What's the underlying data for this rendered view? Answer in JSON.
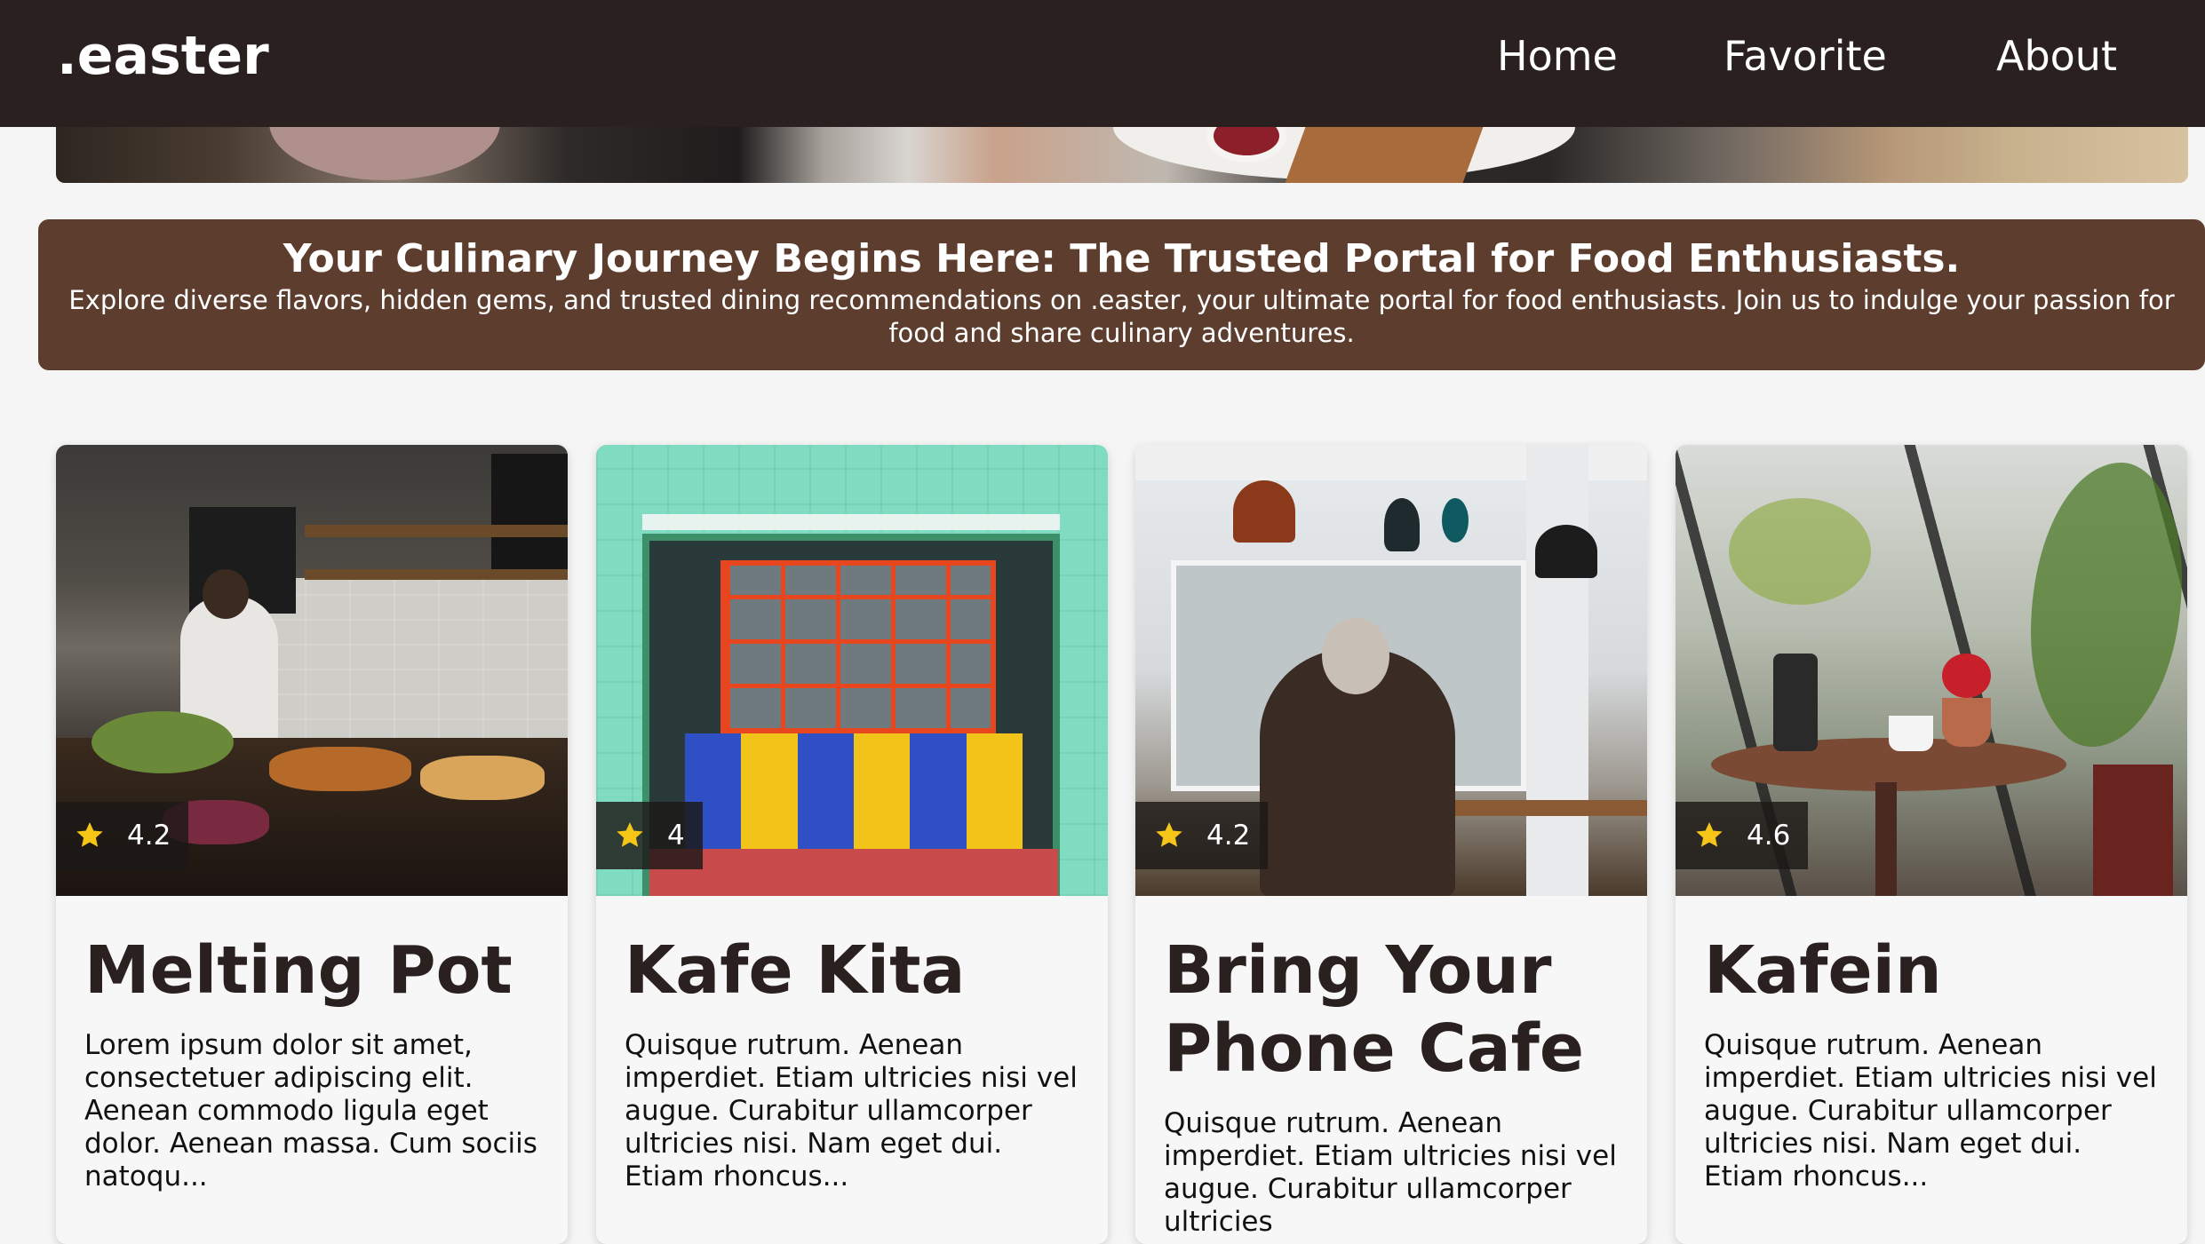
{
  "nav": {
    "brand": ".easter",
    "links": [
      "Home",
      "Favorite",
      "About"
    ]
  },
  "banner": {
    "title": "Your Culinary Journey Begins Here: The Trusted Portal for Food Enthusiasts.",
    "text": "Explore diverse flavors, hidden gems, and trusted dining recommendations on .easter, your ultimate portal for food enthusiasts. Join us to indulge your passion for food and share culinary adventures."
  },
  "cards": [
    {
      "name": "Melting Pot",
      "rating": "4.2",
      "description": "Lorem ipsum dolor sit amet, consectetuer adipiscing elit. Aenean commodo ligula eget dolor. Aenean massa. Cum sociis natoqu..."
    },
    {
      "name": "Kafe Kita",
      "rating": "4",
      "description": "Quisque rutrum. Aenean imperdiet. Etiam ultricies nisi vel augue. Curabitur ullamcorper ultricies nisi. Nam eget dui. Etiam rhoncus..."
    },
    {
      "name": "Bring Your Phone Cafe",
      "rating": "4.2",
      "description": "Quisque rutrum. Aenean imperdiet. Etiam ultricies nisi vel augue. Curabitur ullamcorper ultricies"
    },
    {
      "name": "Kafein",
      "rating": "4.6",
      "description": "Quisque rutrum. Aenean imperdiet. Etiam ultricies nisi vel augue. Curabitur ullamcorper ultricies nisi. Nam eget dui. Etiam rhoncus..."
    }
  ],
  "colors": {
    "navbar": "#2a2020",
    "banner": "#5c3d2e",
    "star": "#f5c518"
  },
  "icons": {
    "rating": "star-icon"
  }
}
